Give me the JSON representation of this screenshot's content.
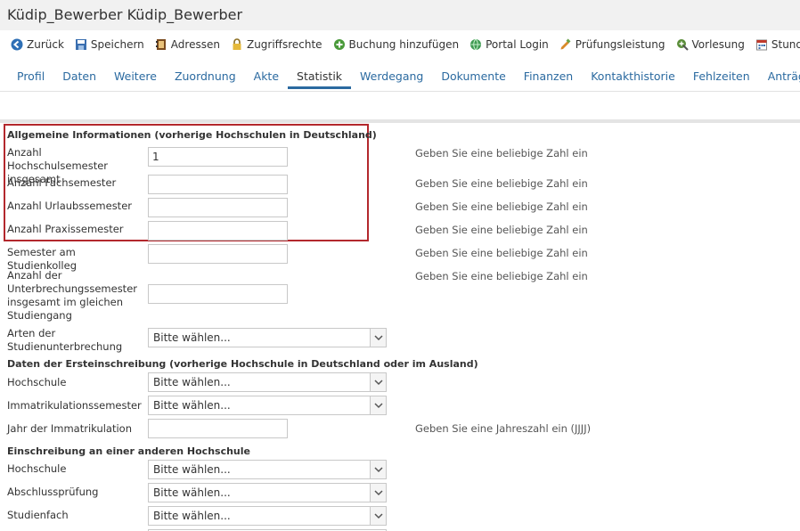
{
  "window": {
    "title": "Küdip_Bewerber Küdip_Bewerber"
  },
  "toolbar": [
    {
      "label": "Zurück",
      "icon": "back-arrow-icon"
    },
    {
      "label": "Speichern",
      "icon": "save-icon"
    },
    {
      "label": "Adressen",
      "icon": "address-book-icon"
    },
    {
      "label": "Zugriffsrechte",
      "icon": "lock-icon"
    },
    {
      "label": "Buchung hinzufügen",
      "icon": "add-circle-icon"
    },
    {
      "label": "Portal Login",
      "icon": "globe-icon"
    },
    {
      "label": "Prüfungsleistung",
      "icon": "exam-icon"
    },
    {
      "label": "Vorlesung",
      "icon": "lecture-icon"
    },
    {
      "label": "Stundenplan",
      "icon": "calendar-icon"
    }
  ],
  "tabs": [
    {
      "label": "Profil"
    },
    {
      "label": "Daten"
    },
    {
      "label": "Weitere"
    },
    {
      "label": "Zuordnung"
    },
    {
      "label": "Akte"
    },
    {
      "label": "Statistik",
      "active": true
    },
    {
      "label": "Werdegang"
    },
    {
      "label": "Dokumente"
    },
    {
      "label": "Finanzen"
    },
    {
      "label": "Kontakthistorie"
    },
    {
      "label": "Fehlzeiten"
    },
    {
      "label": "Anträge"
    }
  ],
  "sections": {
    "general": "Allgemeine Informationen (vorherige Hochschulen in Deutschland)",
    "first_enrollment": "Daten der Ersteinschreibung (vorherige Hochschule in Deutschland oder im Ausland)",
    "other_university": "Einschreibung an einer anderen Hochschule"
  },
  "fields": {
    "hochschulsemester": {
      "label": "Anzahl Hochschulsemester insgesamt",
      "value": "1",
      "hint": "Geben Sie eine beliebige Zahl ein"
    },
    "fachsemester": {
      "label": "Anzahl Fachsemester",
      "value": "",
      "hint": "Geben Sie eine beliebige Zahl ein"
    },
    "urlaubssemester": {
      "label": "Anzahl Urlaubssemester",
      "value": "",
      "hint": "Geben Sie eine beliebige Zahl ein"
    },
    "praxissemester": {
      "label": "Anzahl Praxissemester",
      "value": "",
      "hint": "Geben Sie eine beliebige Zahl ein"
    },
    "studienkolleg": {
      "label": "Semester am Studienkolleg",
      "value": "",
      "hint": "Geben Sie eine beliebige Zahl ein"
    },
    "unterbrechung": {
      "label": "Anzahl der Unterbrechungssemester insgesamt im gleichen Studiengang",
      "value": "",
      "hint": "Geben Sie eine beliebige Zahl ein"
    },
    "arten_unterbrechung": {
      "label": "Arten der Studienunterbrechung",
      "selected": "Bitte wählen..."
    },
    "erst_hochschule": {
      "label": "Hochschule",
      "selected": "Bitte wählen..."
    },
    "immatrikulationssemester": {
      "label": "Immatrikulationssemester",
      "selected": "Bitte wählen..."
    },
    "jahr_immatrikulation": {
      "label": "Jahr der Immatrikulation",
      "value": "",
      "hint": "Geben Sie eine Jahreszahl ein (JJJJ)"
    },
    "andere_hochschule": {
      "label": "Hochschule",
      "selected": "Bitte wählen..."
    },
    "abschlusspruefung": {
      "label": "Abschlussprüfung",
      "selected": "Bitte wählen..."
    },
    "studienfach": {
      "label": "Studienfach",
      "selected": "Bitte wählen..."
    }
  }
}
